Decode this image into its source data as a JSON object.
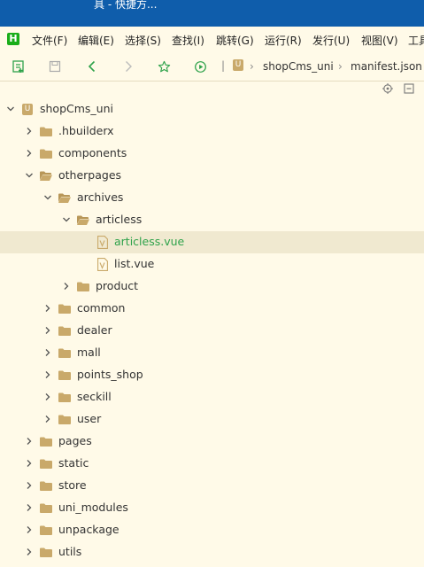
{
  "window": {
    "title": "具 - 快捷方..."
  },
  "menu": {
    "logo": "H",
    "items": [
      {
        "label": "文件(F)"
      },
      {
        "label": "编辑(E)"
      },
      {
        "label": "选择(S)"
      },
      {
        "label": "查找(I)"
      },
      {
        "label": "跳转(G)"
      },
      {
        "label": "运行(R)"
      },
      {
        "label": "发行(U)"
      },
      {
        "label": "视图(V)"
      },
      {
        "label": "工具"
      }
    ]
  },
  "toolbar": {
    "icons": [
      "new-file-icon",
      "save-icon",
      "back-icon",
      "forward-icon",
      "favorite-star-icon",
      "run-icon"
    ],
    "breadcrumb": [
      "shopCms_uni",
      "manifest.json"
    ]
  },
  "tree": [
    {
      "label": "shopCms_uni",
      "type": "project",
      "expanded": true
    },
    {
      "label": ".hbuilderx",
      "type": "folder",
      "expanded": false
    },
    {
      "label": "components",
      "type": "folder",
      "expanded": false
    },
    {
      "label": "otherpages",
      "type": "folder",
      "expanded": true
    },
    {
      "label": "archives",
      "type": "folder",
      "expanded": true
    },
    {
      "label": "articless",
      "type": "folder",
      "expanded": true
    },
    {
      "label": "articless.vue",
      "type": "file",
      "selected": true
    },
    {
      "label": "list.vue",
      "type": "file"
    },
    {
      "label": "product",
      "type": "folder",
      "expanded": false
    },
    {
      "label": "common",
      "type": "folder",
      "expanded": false
    },
    {
      "label": "dealer",
      "type": "folder",
      "expanded": false
    },
    {
      "label": "mall",
      "type": "folder",
      "expanded": false
    },
    {
      "label": "points_shop",
      "type": "folder",
      "expanded": false
    },
    {
      "label": "seckill",
      "type": "folder",
      "expanded": false
    },
    {
      "label": "user",
      "type": "folder",
      "expanded": false
    },
    {
      "label": "pages",
      "type": "folder",
      "expanded": false
    },
    {
      "label": "static",
      "type": "folder",
      "expanded": false
    },
    {
      "label": "store",
      "type": "folder",
      "expanded": false
    },
    {
      "label": "uni_modules",
      "type": "folder",
      "expanded": false
    },
    {
      "label": "unpackage",
      "type": "folder",
      "expanded": false
    },
    {
      "label": "utils",
      "type": "folder",
      "expanded": false
    }
  ],
  "colors": {
    "background": "#fffae8",
    "titlebar": "#0f5dab",
    "folder": "#c9a96a",
    "selected_text": "#2ea24a",
    "selected_row": "#f0e9d0",
    "logo": "#1aad19"
  }
}
